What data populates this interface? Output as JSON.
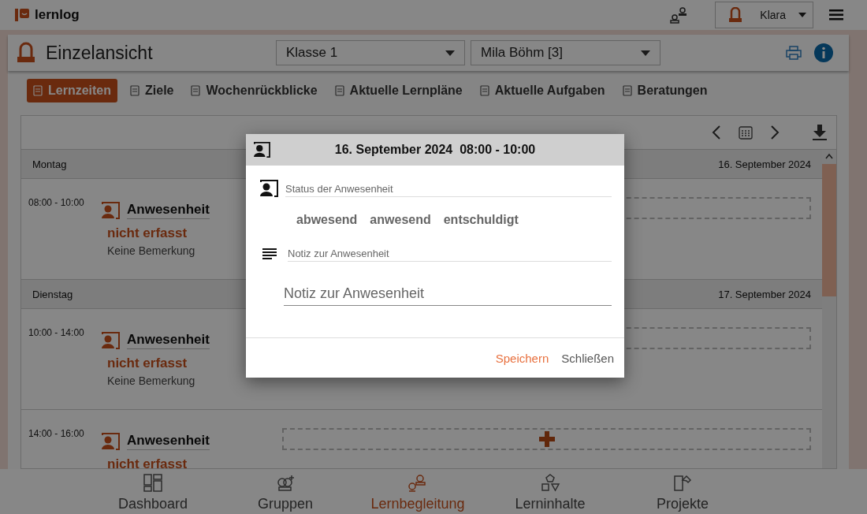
{
  "app": {
    "name": "lernlog"
  },
  "user": {
    "name": "Klara"
  },
  "header": {
    "title": "Einzelansicht",
    "class_select": {
      "value": "Klasse 1"
    },
    "student_select": {
      "value": "Mila Böhm [3]"
    }
  },
  "tabs": [
    {
      "label": "Lernzeiten",
      "selected": true
    },
    {
      "label": "Ziele",
      "selected": false
    },
    {
      "label": "Wochenrückblicke",
      "selected": false
    },
    {
      "label": "Aktuelle Lernpläne",
      "selected": false
    },
    {
      "label": "Aktuelle Aufgaben",
      "selected": false
    },
    {
      "label": "Beratungen",
      "selected": false
    }
  ],
  "calendar": {
    "days": [
      {
        "name": "Montag",
        "date": "16. September 2024",
        "slots": [
          {
            "time": "08:00 - 10:00",
            "title": "Anwesenheit",
            "status": "nicht erfasst",
            "note": "Keine Bemerkung"
          }
        ]
      },
      {
        "name": "Dienstag",
        "date": "17. September 2024",
        "slots": [
          {
            "time": "10:00 - 14:00",
            "title": "Anwesenheit",
            "status": "nicht erfasst",
            "note": "Keine Bemerkung"
          },
          {
            "time": "14:00 - 16:00",
            "title": "Anwesenheit",
            "status": "nicht erfasst",
            "add_icon": true
          }
        ]
      }
    ]
  },
  "dialog": {
    "title": "16. September 2024  08:00 - 10:00",
    "status_label": "Status der Anwesenheit",
    "options": [
      {
        "label": "abwesend",
        "selected": false
      },
      {
        "label": "anwesend",
        "selected": false
      },
      {
        "label": "entschuldigt",
        "selected": false
      }
    ],
    "note_label": "Notiz zur Anwesenheit",
    "note_field": {
      "placeholder": "Notiz zur Anwesenheit"
    },
    "buttons": [
      {
        "label": "Speichern",
        "kind": "primary"
      },
      {
        "label": "Schließen",
        "kind": "secondary"
      }
    ]
  },
  "bottom_nav": [
    {
      "label": "Dashboard",
      "selected": false
    },
    {
      "label": "Gruppen",
      "selected": false
    },
    {
      "label": "Lernbegleitung",
      "selected": true
    },
    {
      "label": "Lerninhalte",
      "selected": false
    },
    {
      "label": "Projekte",
      "selected": false
    }
  ]
}
